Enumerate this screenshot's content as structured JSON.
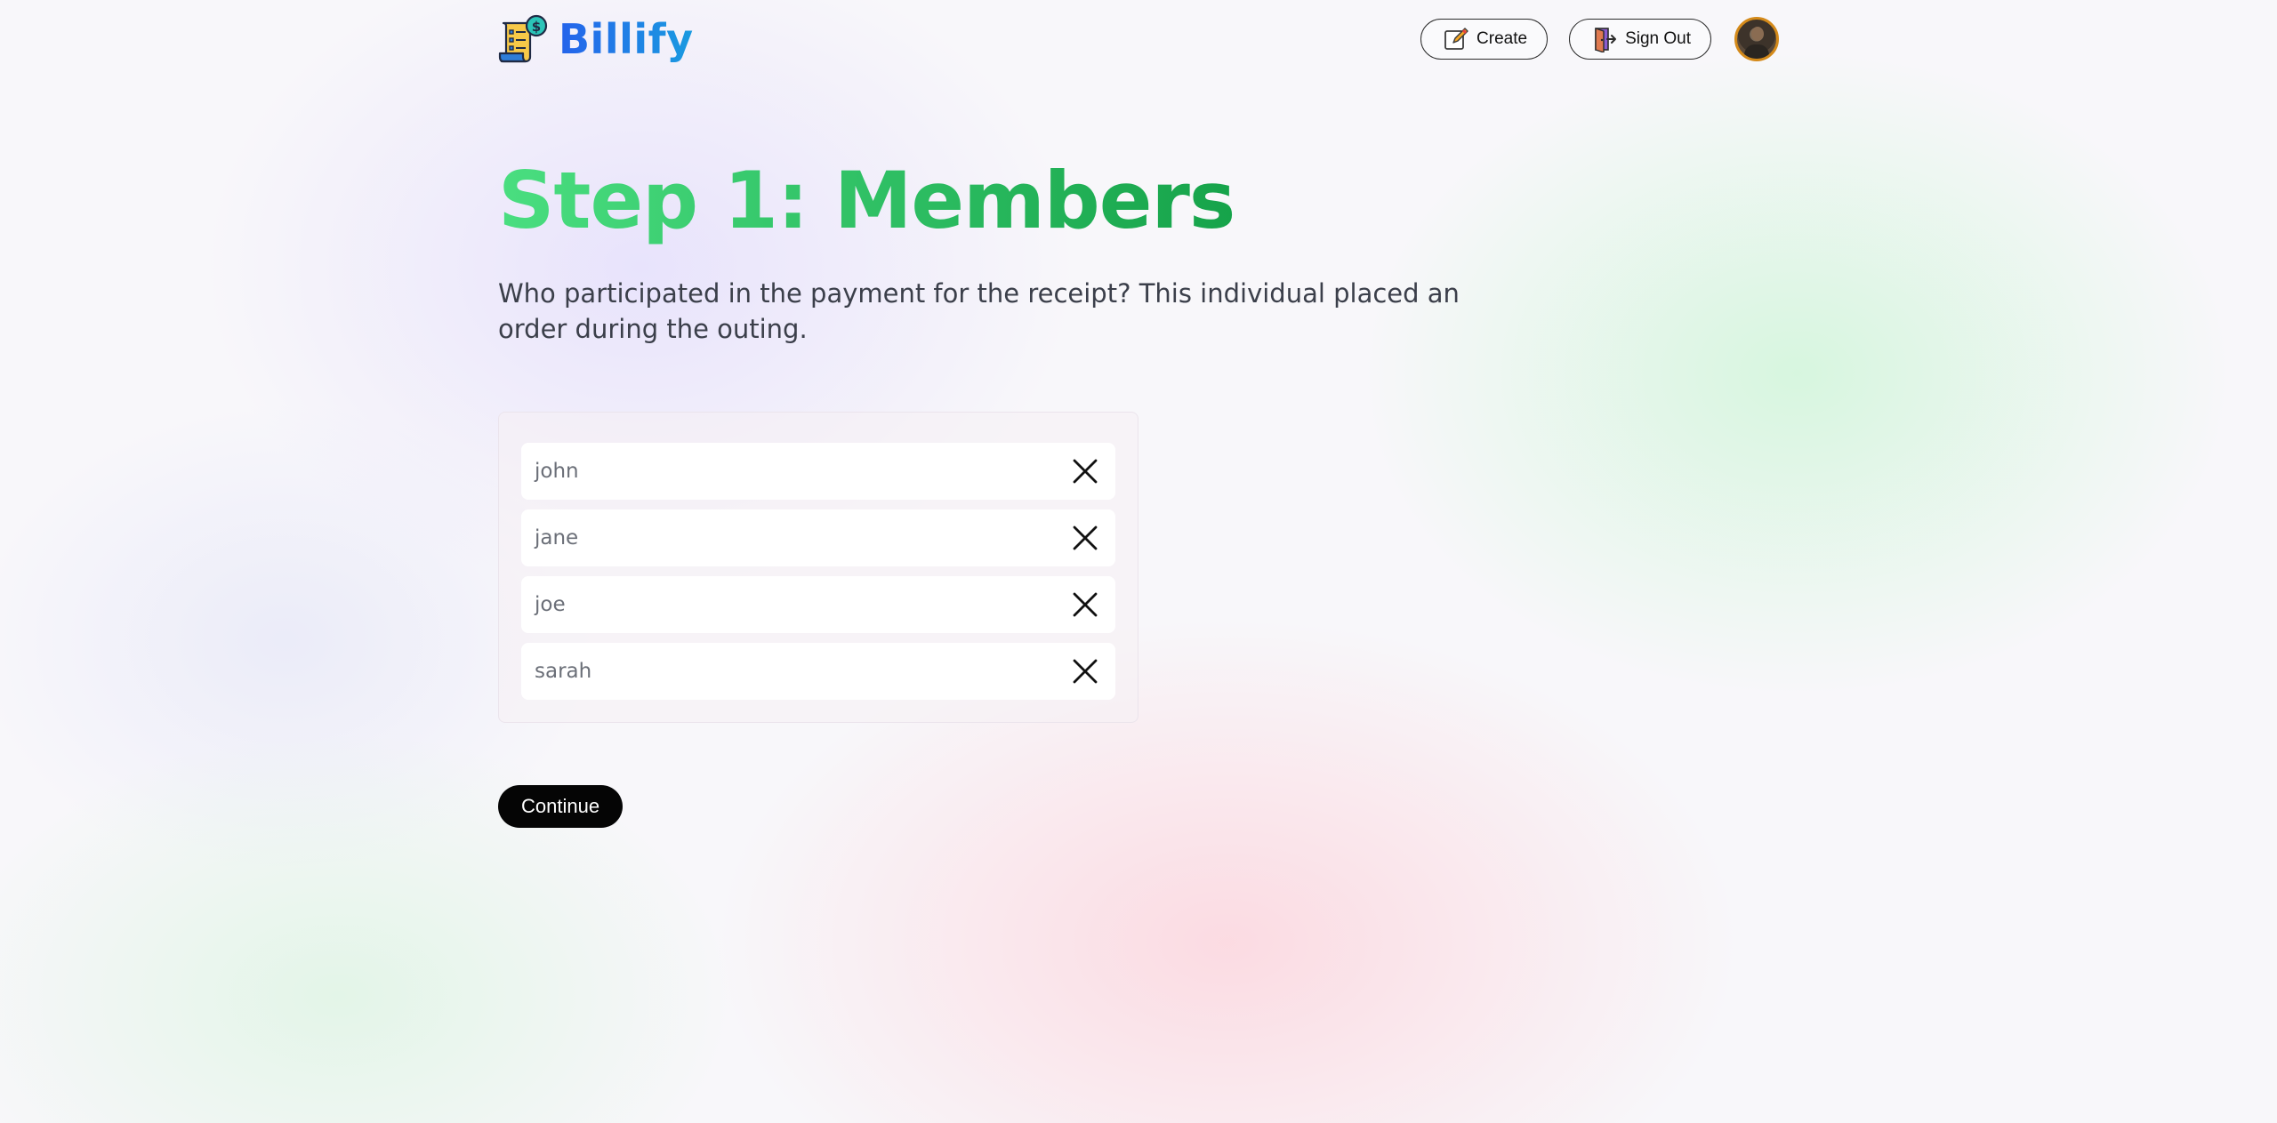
{
  "brand": {
    "name": "Billify",
    "logo_icon": "receipt-dollar-icon"
  },
  "nav": {
    "create_label": "Create",
    "create_icon": "pencil-square-icon",
    "signout_label": "Sign Out",
    "signout_icon": "door-exit-icon",
    "avatar_icon": "user-avatar"
  },
  "step": {
    "title": "Step 1: Members",
    "description": "Who participated in the payment for the receipt? This individual placed an order during the outing."
  },
  "members": [
    {
      "name": "john"
    },
    {
      "name": "jane"
    },
    {
      "name": "joe"
    },
    {
      "name": "sarah"
    }
  ],
  "continue_label": "Continue",
  "colors": {
    "brand_blue": "#1d72d8",
    "title_green_start": "#4ade80",
    "title_green_end": "#16a34a",
    "button_black": "#050505"
  }
}
